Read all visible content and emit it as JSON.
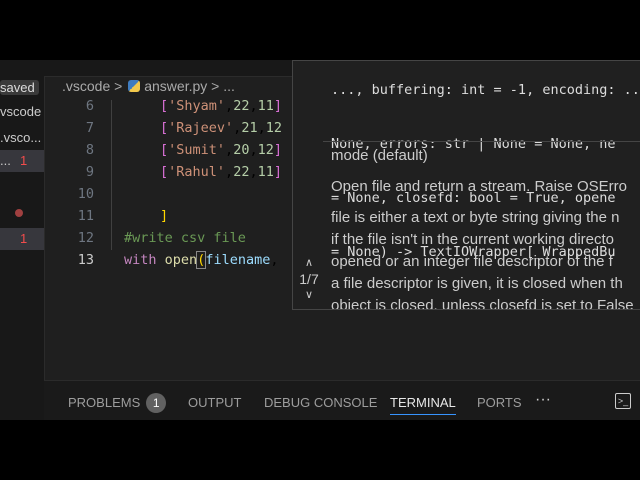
{
  "sidebar": {
    "items": [
      {
        "label": "saved"
      },
      {
        "label": "vscode"
      },
      {
        "label": ".vsco..."
      },
      {
        "label": "...",
        "badge": "1"
      },
      {
        "label": "",
        "dot": true
      },
      {
        "label": "",
        "badge": "1"
      }
    ]
  },
  "breadcrumb": {
    "folder": ".vscode",
    "sep": ">",
    "file": "answer.py",
    "rest": "..."
  },
  "code": {
    "lines": [
      {
        "n": "6",
        "t": "['Shyam',22,11]"
      },
      {
        "n": "7",
        "t": "['Rajeev',21,12"
      },
      {
        "n": "8",
        "t": "['Sumit',20,12]"
      },
      {
        "n": "9",
        "t": "['Rahul',22,11]"
      },
      {
        "n": "10",
        "t": ""
      },
      {
        "n": "11",
        "t": "]"
      },
      {
        "n": "12",
        "t": "#write csv file"
      },
      {
        "n": "13",
        "t": "with open(filename,"
      }
    ]
  },
  "hover": {
    "signature": [
      "..., buffering: int = -1, encoding: ...",
      "None, errors: str | None = None, ne",
      "= None, closefd: bool = True, opene",
      "= None) -> TextIOWrapper[_WrappedBu"
    ],
    "param": "mode (default)",
    "summary": "Open file and return a stream. Raise OSErro",
    "body": [
      "file is either a text or byte string giving the n",
      "if the file isn't in the current working directo",
      "opened or an integer file descriptor of the f",
      "a file descriptor is given, it is closed when th",
      "object is closed, unless closefd is set to False"
    ],
    "counter": "1/7",
    "up": "^",
    "down": "v"
  },
  "panel": {
    "tabs": [
      {
        "label": "PROBLEMS",
        "badge": "1"
      },
      {
        "label": "OUTPUT"
      },
      {
        "label": "DEBUG CONSOLE"
      },
      {
        "label": "TERMINAL",
        "active": true
      },
      {
        "label": "PORTS"
      }
    ],
    "more": "···",
    "terminal_icon": ">_"
  }
}
